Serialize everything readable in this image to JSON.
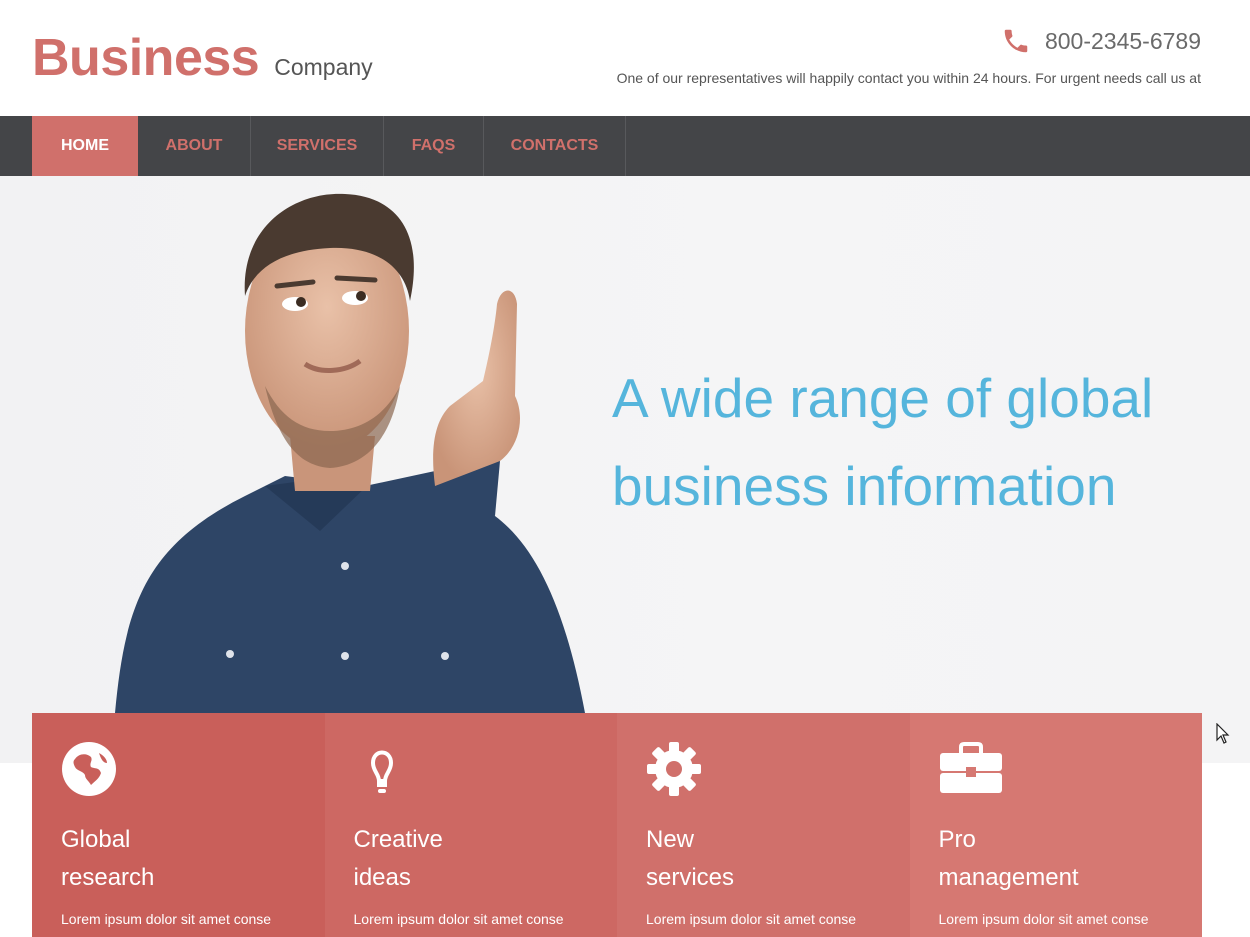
{
  "header": {
    "brand_name": "Business",
    "brand_tagline": "Company",
    "phone_icon": "phone-icon",
    "phone_number": "800-2345-6789",
    "contact_note": "One of our representatives will happily contact you within 24 hours. For urgent needs call us at"
  },
  "nav": {
    "items": [
      {
        "label": "HOME",
        "active": true
      },
      {
        "label": "ABOUT",
        "active": false
      },
      {
        "label": "SERVICES",
        "active": false
      },
      {
        "label": "FAQS",
        "active": false
      },
      {
        "label": "CONTACTS",
        "active": false
      }
    ]
  },
  "hero": {
    "headline_line1": "A wide range of global",
    "headline_line2": "business information",
    "image": "man-pointing-up-photo"
  },
  "features": [
    {
      "icon": "globe-icon",
      "title_line1": "Global",
      "title_line2": "research",
      "text": "Lorem ipsum dolor sit amet conse",
      "color": "#c95f5a"
    },
    {
      "icon": "lightbulb-icon",
      "title_line1": "Creative",
      "title_line2": "ideas",
      "text": "Lorem ipsum dolor sit amet conse",
      "color": "#cd6863"
    },
    {
      "icon": "gear-icon",
      "title_line1": "New",
      "title_line2": "services",
      "text": "Lorem ipsum dolor sit amet conse",
      "color": "#d0706b"
    },
    {
      "icon": "briefcase-icon",
      "title_line1": "Pro",
      "title_line2": "management",
      "text": "Lorem ipsum dolor sit amet conse",
      "color": "#d67872"
    }
  ],
  "colors": {
    "accent": "#d0706b",
    "nav_background": "#444548",
    "headline": "#55b5dc"
  }
}
